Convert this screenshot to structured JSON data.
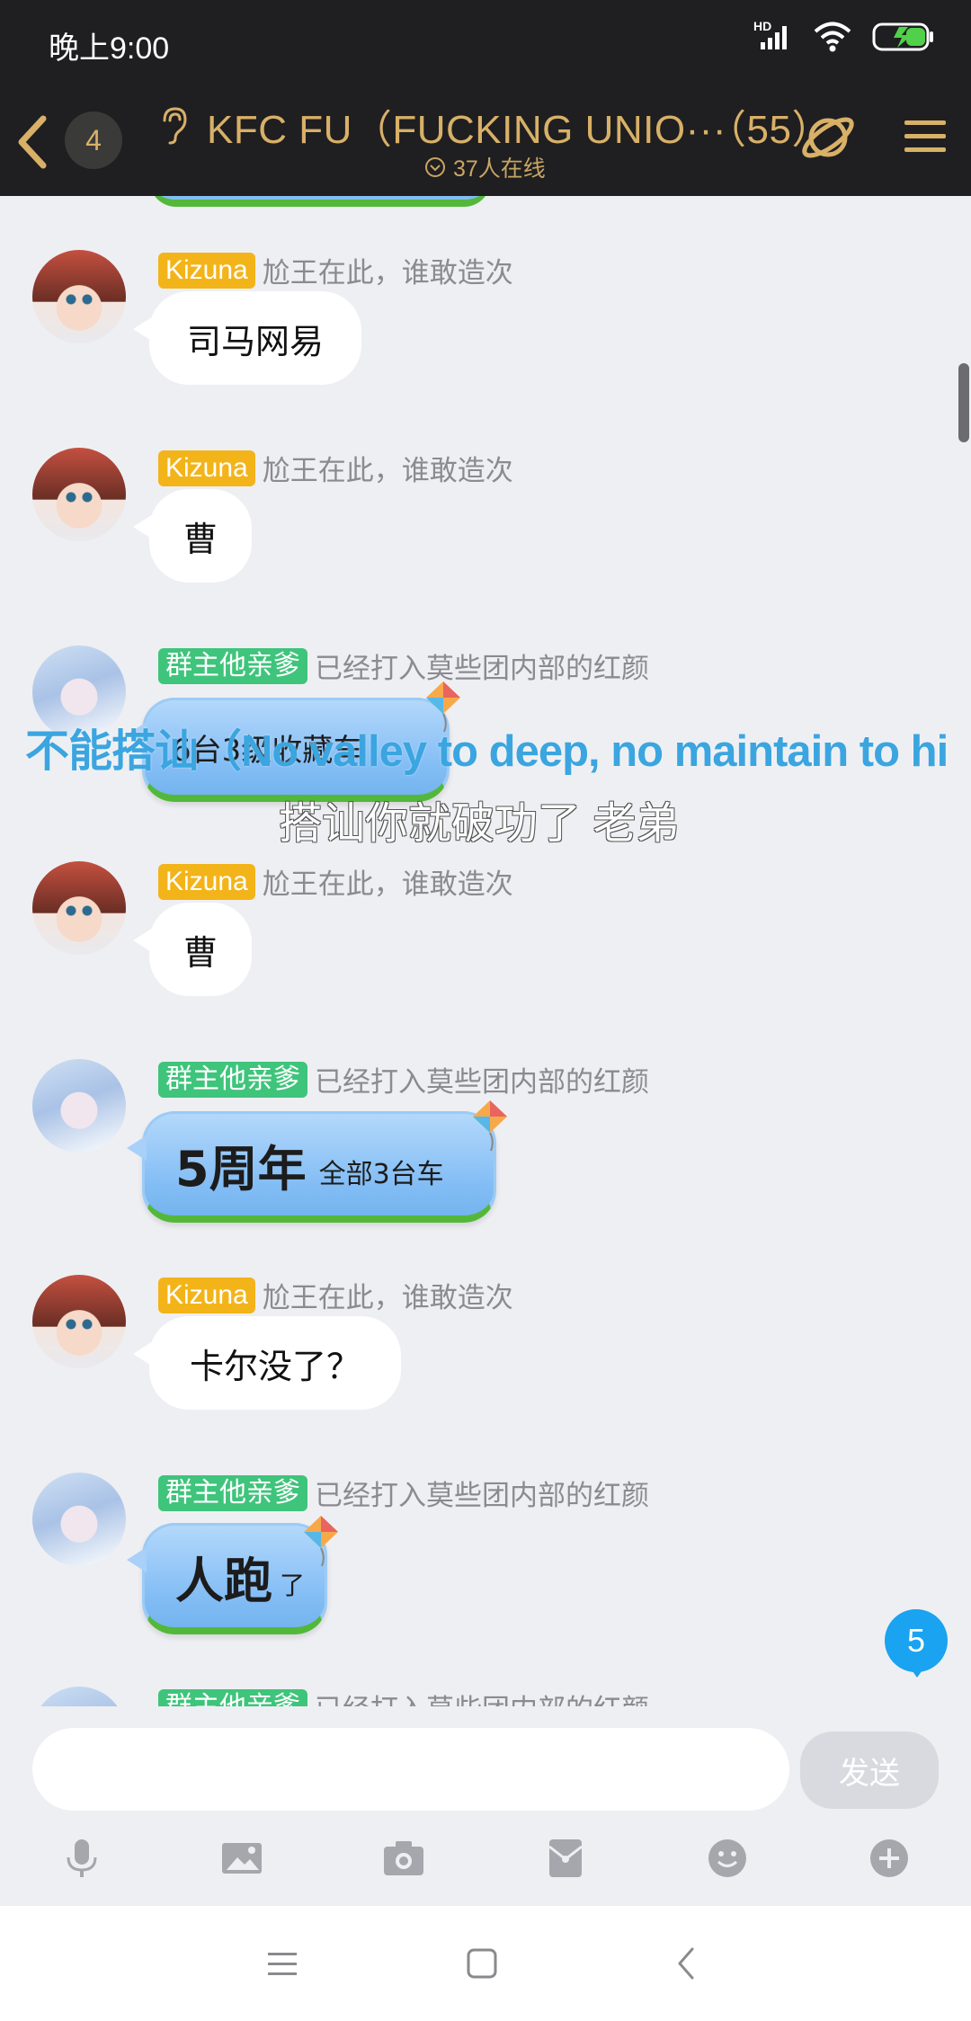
{
  "status": {
    "time": "晚上9:00",
    "network_label": "HD"
  },
  "header": {
    "unread_count": "4",
    "title": "KFC FU（FUCKING UNIO···（55）",
    "online_text": "37人在线"
  },
  "chat": {
    "messages": [
      {
        "badge": "Kizuna",
        "title": "尬王在此，谁敢造次",
        "text": "司马网易"
      },
      {
        "badge": "Kizuna",
        "title": "尬王在此，谁敢造次",
        "text": "曹"
      },
      {
        "badge": "群主他亲爹",
        "title": "已经打入莫些团内部的红颜",
        "text": "6台3级收藏车"
      },
      {
        "badge": "Kizuna",
        "title": "尬王在此，谁敢造次",
        "text": "曹"
      },
      {
        "badge": "群主他亲爹",
        "title": "已经打入莫些团内部的红颜",
        "text_big": "5周年",
        "text_small": "全部3台车"
      },
      {
        "badge": "Kizuna",
        "title": "尬王在此，谁敢造次",
        "text": "卡尔没了？"
      },
      {
        "badge": "群主他亲爹",
        "title": "已经打入莫些团内部的红颜",
        "text_big": "人跑",
        "text_small": "了"
      },
      {
        "badge": "群主他亲爹",
        "title": "已经打入莫些团内部的红颜"
      }
    ],
    "new_message_count": "5"
  },
  "danmaku": [
    "不能搭讪（No valley to deep, no maintain to hi",
    "搭讪你就破功了 老弟"
  ],
  "input": {
    "placeholder": "",
    "send_label": "发送"
  },
  "toolbar_icons": [
    "microphone-icon",
    "image-icon",
    "camera-icon",
    "red-packet-icon",
    "emoji-icon",
    "plus-icon"
  ],
  "nav_icons": [
    "menu-icon",
    "home-icon",
    "back-icon"
  ],
  "colors": {
    "header_bg": "#1f1f21",
    "header_text": "#d8b067",
    "gold_badge": "#f3b41a",
    "green_badge": "#3fc47b",
    "accent_blue": "#19a3f0"
  }
}
